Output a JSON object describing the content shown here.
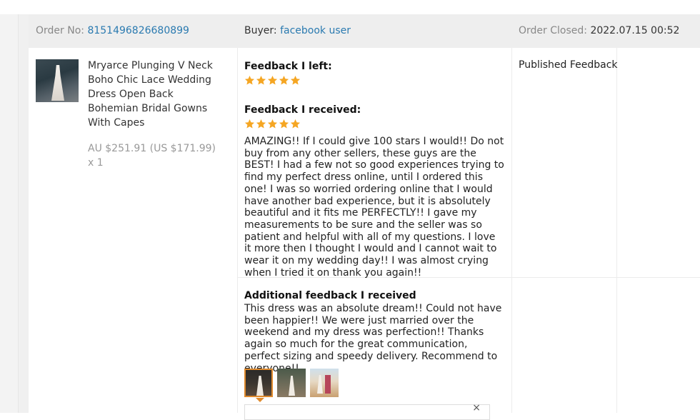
{
  "order": {
    "order_no_label": "Order No:",
    "order_no": "8151496826680899",
    "buyer_label": "Buyer:",
    "buyer": "facebook user",
    "closed_label": "Order Closed:",
    "closed_time": "2022.07.15 00:52"
  },
  "product": {
    "title": "Mryarce Plunging V Neck Boho Chic Lace Wedding Dress Open Back Bohemian Bridal Gowns With Capes",
    "price": "AU $251.91 (US $171.99) x 1"
  },
  "feedback": {
    "left_heading": "Feedback I left:",
    "left_stars": 5,
    "received_heading": "Feedback I received:",
    "received_stars": 5,
    "received_text": "AMAZING!! If I could give 100 stars I would!! Do not buy from any other sellers, these guys are the BEST! I had a few not so good experiences trying to find my perfect dress online, until I ordered this one! I was so worried ordering online that I would have another bad experience, but it is absolutely beautiful and it fits me PERFECTLY!! I gave my measurements to be sure and the seller was so patient and helpful with all of my questions. I love it more then I thought I would and I cannot wait to wear it on my wedding day!! I was almost crying when I tried it on thank you again!!",
    "additional_heading": "Additional feedback I received",
    "additional_text": "This dress was an absolute dream!! Could not have been happier!! We were just married over the weekend and my dress was perfection!! Thanks again so much for the great communication, perfect sizing and speedy delivery. Recommend to everyone!!",
    "status": "Published Feedback",
    "star_color": "#f5a623",
    "accent_color": "#e08a2c",
    "link_color": "#2a7ab0"
  },
  "preview": {
    "close_icon": "×"
  }
}
